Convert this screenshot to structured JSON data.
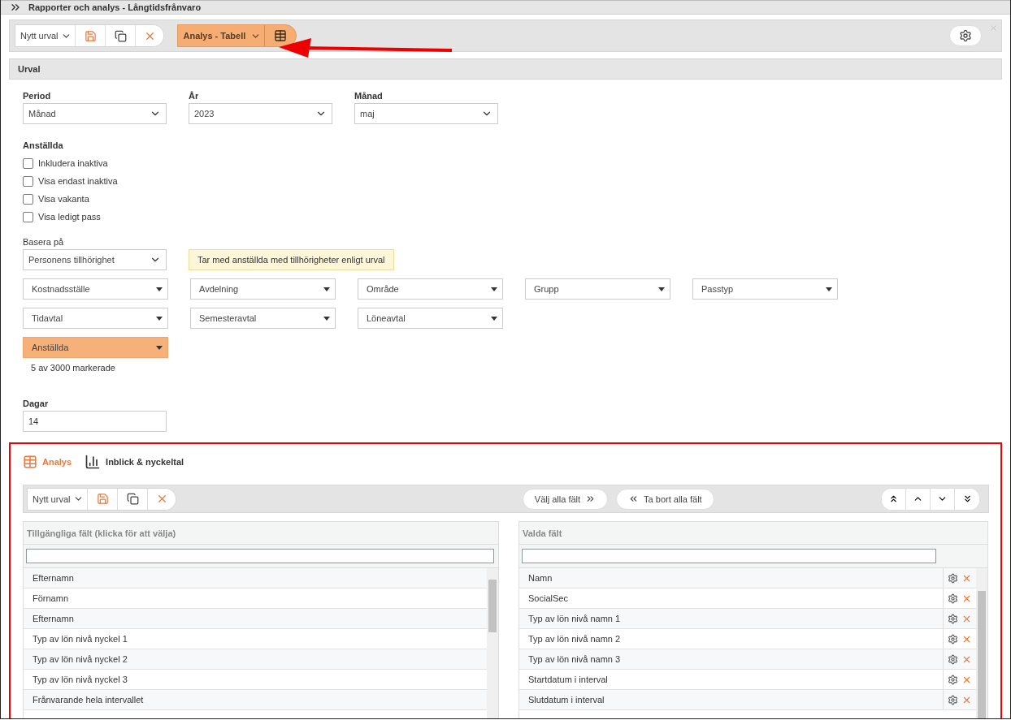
{
  "title": "Rapporter och analys - Långtidsfrånvaro",
  "toolbar": {
    "selection": "Nytt urval",
    "view": "Analys - Tabell"
  },
  "section_title": "Urval",
  "period_fields": [
    {
      "label": "Period",
      "value": "Månad"
    },
    {
      "label": "År",
      "value": "2023"
    },
    {
      "label": "Månad",
      "value": "maj"
    }
  ],
  "employees": {
    "label": "Anställda",
    "options": [
      {
        "label": "Inkludera inaktiva",
        "checked": false
      },
      {
        "label": "Visa endast inaktiva",
        "checked": false
      },
      {
        "label": "Visa vakanta",
        "checked": false
      },
      {
        "label": "Visa ledigt pass",
        "checked": false
      }
    ]
  },
  "base_on": {
    "label": "Basera på",
    "value": "Personens tillhörighet",
    "note": "Tar med anställda med tillhörigheter enligt urval"
  },
  "filter_rows": [
    [
      {
        "label": "Kostnadsställe",
        "highlighted": false
      },
      {
        "label": "Avdelning",
        "highlighted": false
      },
      {
        "label": "Område",
        "highlighted": false
      },
      {
        "label": "Grupp",
        "highlighted": false
      },
      {
        "label": "Passtyp",
        "highlighted": false
      }
    ],
    [
      {
        "label": "Tidavtal",
        "highlighted": false
      },
      {
        "label": "Semesteravtal",
        "highlighted": false
      },
      {
        "label": "Löneavtal",
        "highlighted": false
      }
    ],
    [
      {
        "label": "Anställda",
        "highlighted": true
      }
    ]
  ],
  "selection_count": "5 av 3000 markerade",
  "days": {
    "label": "Dagar",
    "value": "14"
  },
  "analysis": {
    "tabs": [
      {
        "label": "Analys",
        "selected": true,
        "kind": "table"
      },
      {
        "label": "Inblick & nyckeltal",
        "selected": false,
        "kind": "chart"
      }
    ],
    "toolbar": {
      "selection": "Nytt urval",
      "select_all": "Välj alla fält",
      "remove_all": "Ta bort alla fält"
    },
    "available": {
      "heading": "Tillgängliga fält (klicka för att välja)",
      "items": [
        "Efternamn",
        "Förnamn",
        "Efternamn",
        "Typ av lön nivå nyckel 1",
        "Typ av lön nivå nyckel 2",
        "Typ av lön nivå nyckel 3",
        "Frånvarande hela intervallet"
      ]
    },
    "chosen": {
      "heading": "Valda fält",
      "items": [
        "Namn",
        "SocialSec",
        "Typ av lön nivå namn 1",
        "Typ av lön nivå namn 2",
        "Typ av lön nivå namn 3",
        "Startdatum i interval",
        "Slutdatum i interval"
      ]
    }
  }
}
